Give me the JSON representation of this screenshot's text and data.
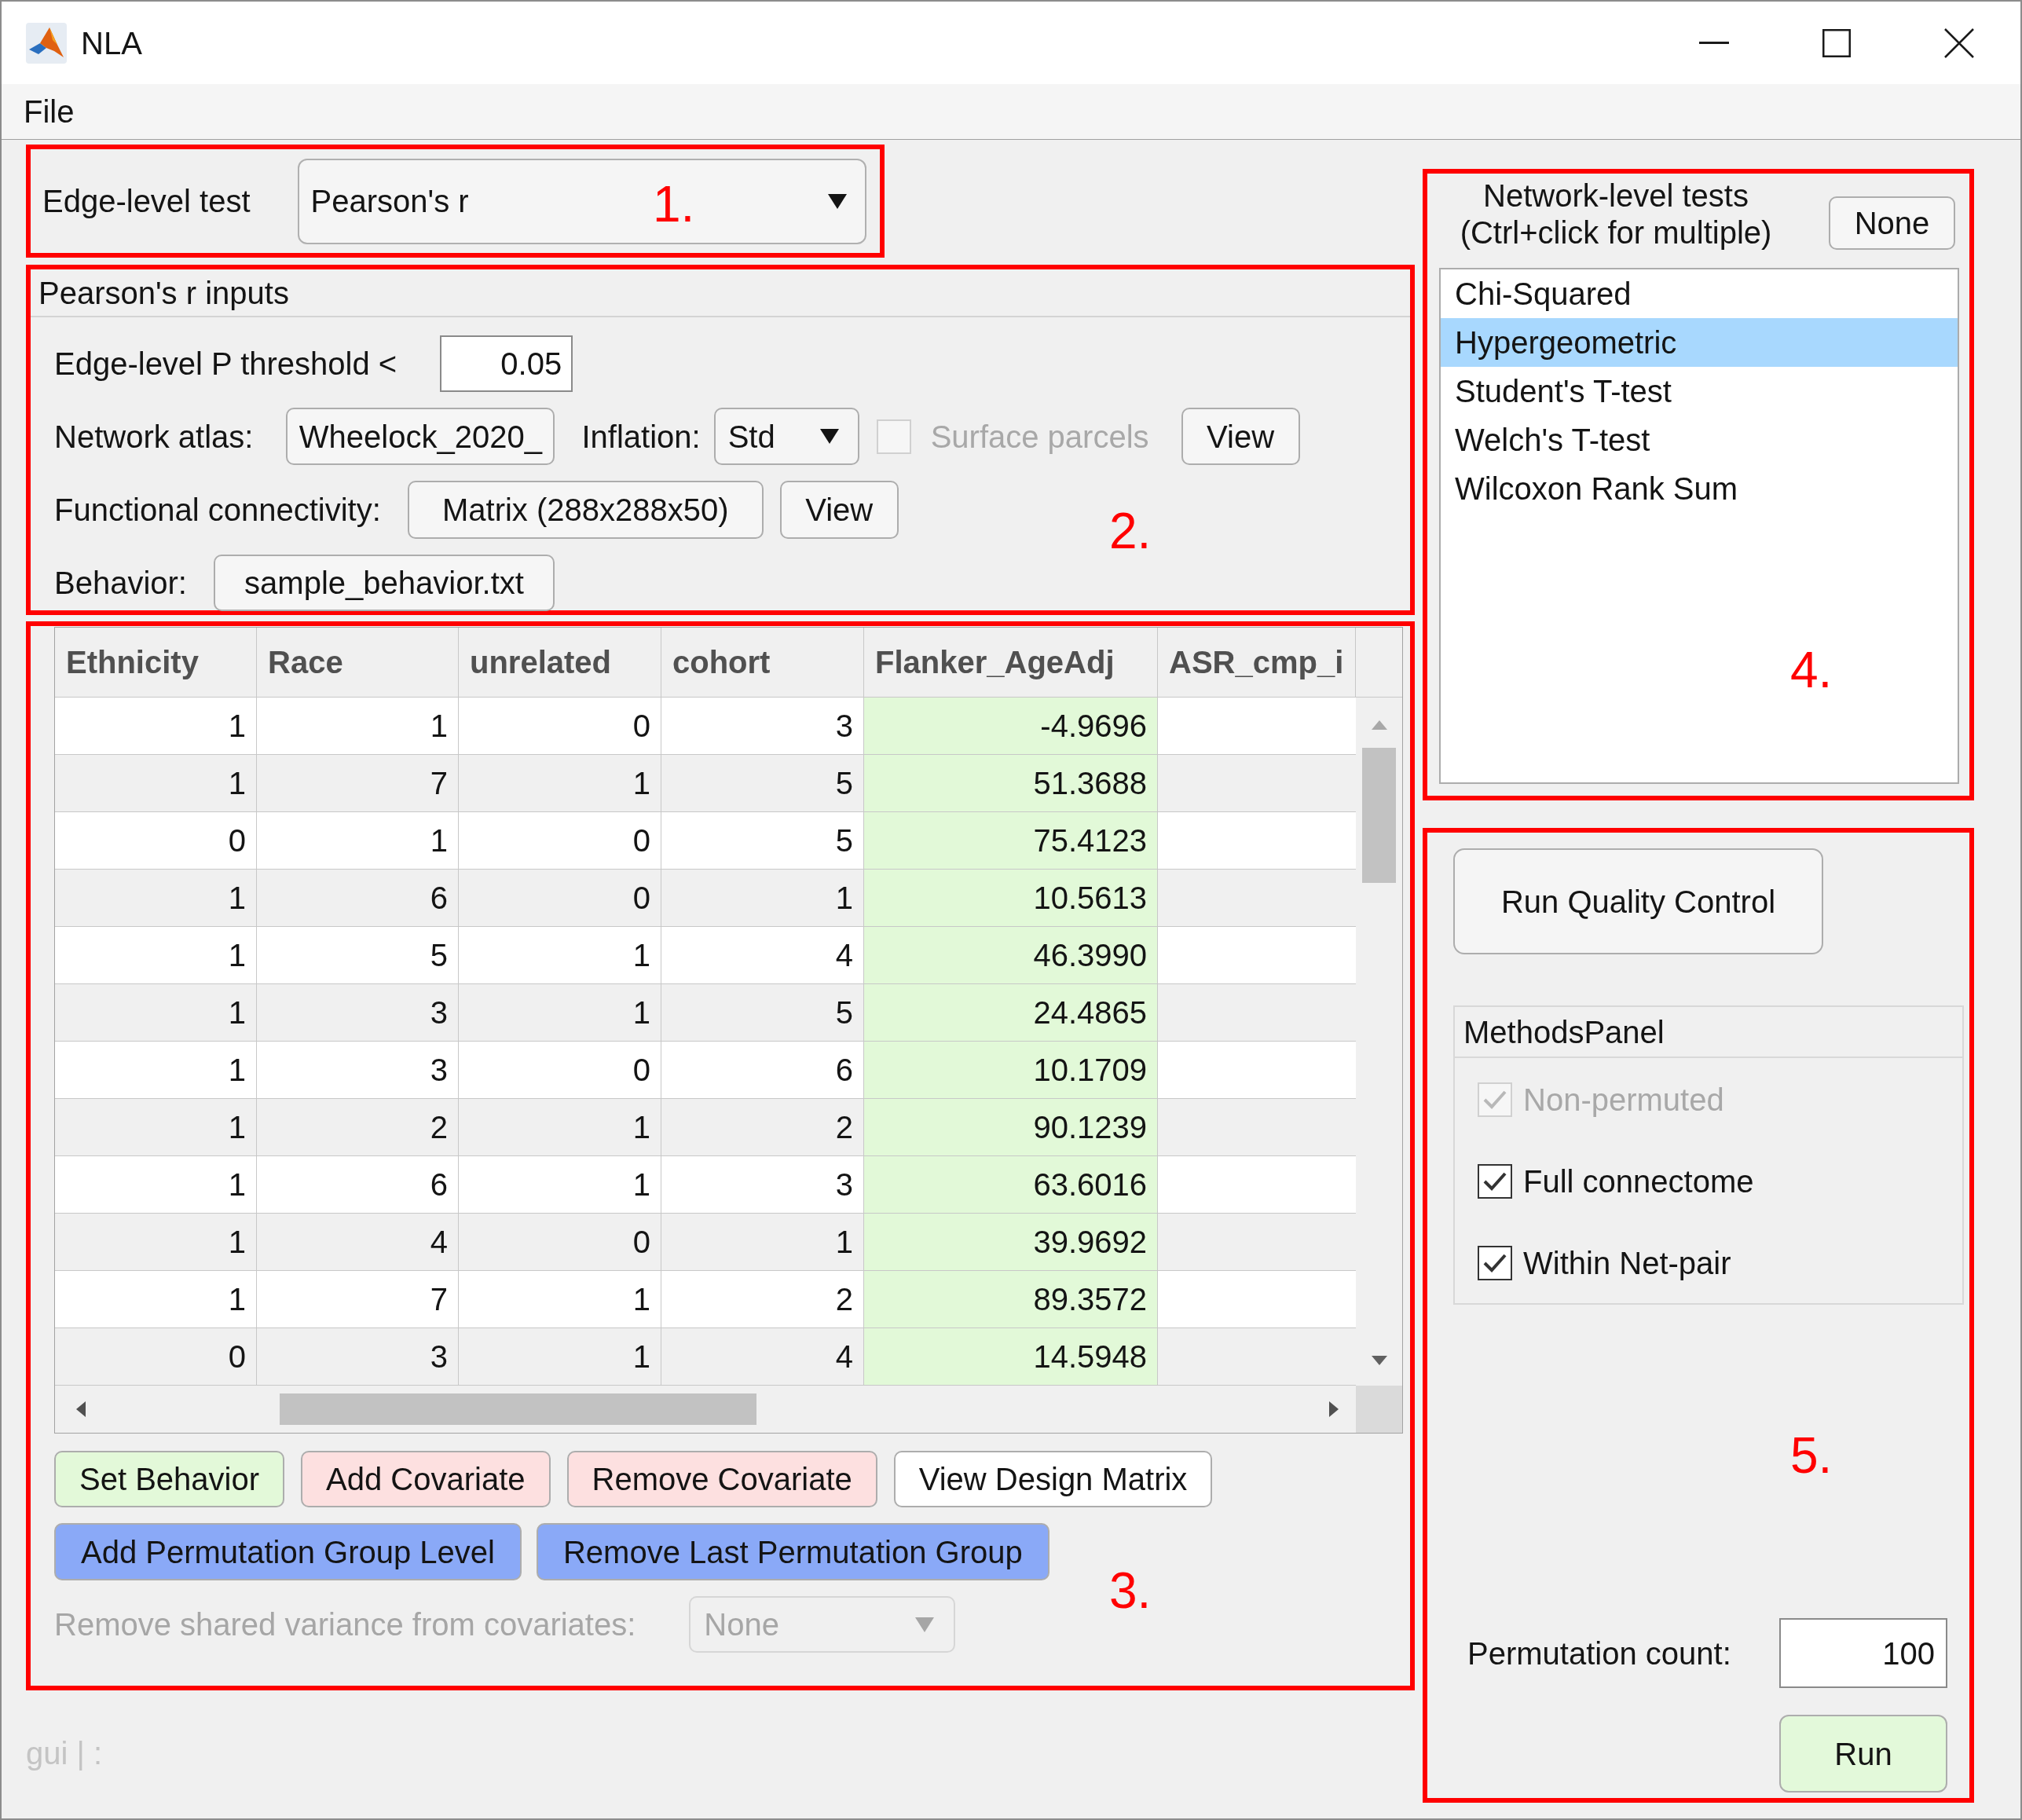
{
  "window": {
    "title": "NLA"
  },
  "menu": [
    {
      "label": "File"
    }
  ],
  "edge_level_test": {
    "annotation": "1.",
    "label": "Edge-level test",
    "value": "Pearson's r"
  },
  "inputs_panel": {
    "annotation": "2.",
    "title": "Pearson's r inputs",
    "p_threshold": {
      "label": "Edge-level P threshold <",
      "value": "0.05"
    },
    "network_atlas": {
      "label": "Network atlas:",
      "button": "Wheelock_2020_"
    },
    "inflation": {
      "label": "Inflation:",
      "value": "Std"
    },
    "surface_parcels": {
      "label": "Surface parcels",
      "checked": false,
      "disabled": true
    },
    "atlas_view_button": "View",
    "functional_connectivity": {
      "label": "Functional connectivity:",
      "button": "Matrix (288x288x50)",
      "view_button": "View"
    },
    "behavior": {
      "label": "Behavior:",
      "button": "sample_behavior.txt"
    }
  },
  "behavior_panel": {
    "annotation": "3.",
    "table": {
      "columns": [
        {
          "label": "Ethnicity",
          "selected": false
        },
        {
          "label": "Race",
          "selected": false
        },
        {
          "label": "unrelated",
          "selected": false
        },
        {
          "label": "cohort",
          "selected": false
        },
        {
          "label": "Flanker_AgeAdj",
          "selected": true
        },
        {
          "label": "ASR_cmp_i",
          "selected": false
        }
      ],
      "rows": [
        [
          "1",
          "1",
          "0",
          "3",
          "-4.9696"
        ],
        [
          "1",
          "7",
          "1",
          "5",
          "51.3688"
        ],
        [
          "0",
          "1",
          "0",
          "5",
          "75.4123"
        ],
        [
          "1",
          "6",
          "0",
          "1",
          "10.5613"
        ],
        [
          "1",
          "5",
          "1",
          "4",
          "46.3990"
        ],
        [
          "1",
          "3",
          "1",
          "5",
          "24.4865"
        ],
        [
          "1",
          "3",
          "0",
          "6",
          "10.1709"
        ],
        [
          "1",
          "2",
          "1",
          "2",
          "90.1239"
        ],
        [
          "1",
          "6",
          "1",
          "3",
          "63.6016"
        ],
        [
          "1",
          "4",
          "0",
          "1",
          "39.9692"
        ],
        [
          "1",
          "7",
          "1",
          "2",
          "89.3572"
        ],
        [
          "0",
          "3",
          "1",
          "4",
          "14.5948"
        ]
      ]
    },
    "button_rows": [
      [
        {
          "label": "Set Behavior",
          "color": "#e3f9d9"
        },
        {
          "label": "Add Covariate",
          "color": "#fde0e0"
        },
        {
          "label": "Remove Covariate",
          "color": "#fde0e0"
        },
        {
          "label": "View Design Matrix",
          "color": "#ffffff"
        }
      ],
      [
        {
          "label": "Add Permutation Group Level",
          "color": "#8aa9f7"
        },
        {
          "label": "Remove Last Permutation Group",
          "color": "#8aa9f7"
        }
      ]
    ],
    "shared_variance": {
      "label": "Remove shared variance from covariates:",
      "value": "None",
      "disabled": true
    }
  },
  "status_bar": {
    "text": "gui | :"
  },
  "network_tests": {
    "annotation": "4.",
    "title": "Network-level tests",
    "subtitle": "(Ctrl+click for multiple)",
    "none_button": "None",
    "items": [
      {
        "label": "Chi-Squared",
        "selected": false
      },
      {
        "label": "Hypergeometric",
        "selected": true
      },
      {
        "label": "Student's T-test",
        "selected": false
      },
      {
        "label": "Welch's T-test",
        "selected": false
      },
      {
        "label": "Wilcoxon Rank Sum",
        "selected": false
      }
    ]
  },
  "run_panel": {
    "annotation": "5.",
    "qc_button": "Run Quality Control",
    "methods_panel": {
      "title": "MethodsPanel",
      "options": [
        {
          "label": "Non-permuted",
          "checked": true,
          "disabled": true
        },
        {
          "label": "Full connectome",
          "checked": true,
          "disabled": false
        },
        {
          "label": "Within Net-pair",
          "checked": true,
          "disabled": false
        }
      ]
    },
    "permutation_count": {
      "label": "Permutation count:",
      "value": "100"
    },
    "run_button": "Run"
  }
}
